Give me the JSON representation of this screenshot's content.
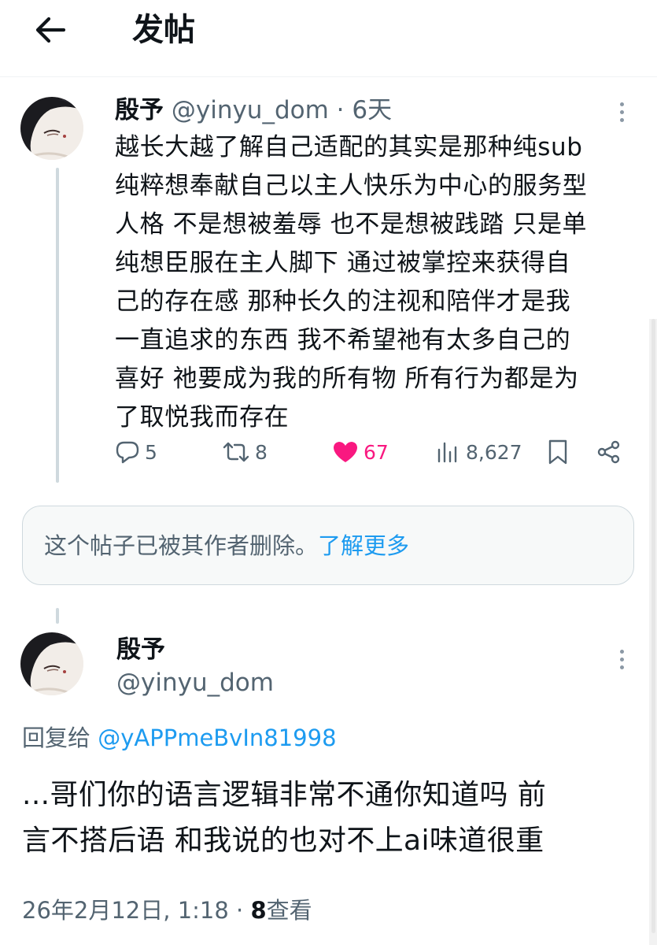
{
  "header": {
    "title": "发帖"
  },
  "tweet1": {
    "name": "殷予",
    "handle": "@yinyu_dom",
    "separator": "·",
    "time": "6天",
    "lines": [
      "越长大越了解自己适配的其实是那种纯sub",
      "纯粹想奉献自己以主人快乐为中心的服务型",
      "人格 不是想被羞辱 也不是想被践踏 只是单",
      "纯想臣服在主人脚下 通过被掌控来获得自",
      "己的存在感 那种长久的注视和陪伴才是我",
      "一直追求的东西 我不希望祂有太多自己的",
      "喜好 祂要成为我的所有物 所有行为都是为",
      "了取悦我而存在"
    ],
    "actions": {
      "replies": "5",
      "reposts": "8",
      "likes": "67",
      "views": "8,627"
    },
    "colors": {
      "like": "#f91880"
    }
  },
  "deleted_notice": {
    "text": "这个帖子已被其作者删除。",
    "link": "了解更多"
  },
  "tweet2": {
    "name": "殷予",
    "handle": "@yinyu_dom",
    "reply_prefix": "回复给 ",
    "reply_handle": "@yAPPmeBvIn81998",
    "lines": [
      "...哥们你的语言逻辑非常不通你知道吗 前",
      "言不搭后语 和我说的也对不上ai味道很重"
    ],
    "timestamp": "26年2月12日, 1:18",
    "separator": " · ",
    "views_count": "8",
    "views_label": "查看"
  },
  "colors": {
    "link": "#1d9bf0",
    "muted": "#536471",
    "text": "#0f1419"
  },
  "icons": [
    "back-arrow-icon",
    "avatar-image",
    "more-icon",
    "reply-icon",
    "repost-icon",
    "like-icon",
    "views-icon",
    "bookmark-icon",
    "share-icon"
  ]
}
